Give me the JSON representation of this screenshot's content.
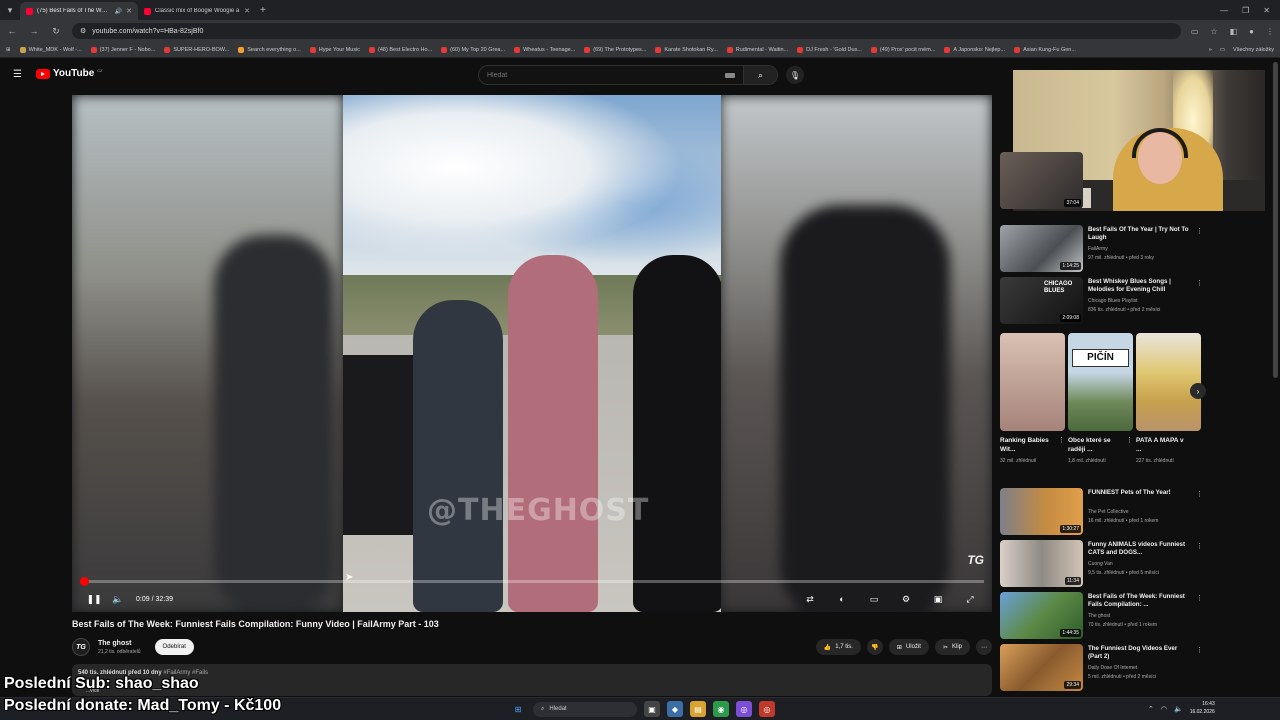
{
  "browser": {
    "tabs": [
      {
        "title": "(75) Best Fails of The Week:",
        "active": true,
        "audio": true
      },
      {
        "title": "Classic mix of Boogie Woogie a",
        "active": false,
        "audio": false
      }
    ],
    "url": "youtube.com/watch?v=HBa-82sjBf0",
    "bookmarks": [
      "White_MDK - Wolf -...",
      "(37) Jenner F - Nobo...",
      "SUPER-HERO-BOW...",
      "Search everything o...",
      "Hype Your Music",
      "(48) Best Electro Ho...",
      "(60) My Top 20 Grea...",
      "Wheatus - Teenage...",
      "(69) The Prototypes...",
      "Karate Shotokan Ry...",
      "Rudimental - Waitin...",
      "DJ Fresh - 'Gold Dus...",
      "(49) Prox' pocit rném...",
      "A Japonsko: Nejlep...",
      "Asian Kung-Fu Gen..."
    ],
    "bookmarks_folder": "Všechny záložky"
  },
  "youtube": {
    "logo_text": "YouTube",
    "logo_region": "CZ",
    "search_placeholder": "Hledat"
  },
  "player": {
    "watermark": "@THEGHOST",
    "channel_mark": "TG",
    "time": "0:09 / 32:39",
    "progress_fraction": 0.0046
  },
  "video": {
    "title": "Best Fails of The Week: Funniest Fails Compilation: Funny Video | FailArmy Part - 103",
    "channel": "The ghost",
    "subscribers": "21,2 tis. odběratelů",
    "subscribe_label": "Odebírat",
    "likes": "1,7 tis.",
    "save_label": "Uložit",
    "clip_label": "Klip",
    "description_meta": "540 tis. zhlédnutí  před 10 dny",
    "description_tags": "#FailArmy #Fails",
    "more_label": "...více"
  },
  "overlay": {
    "line1": "Poslední Sub: shao_shao",
    "line2": "Poslední donate: Mad_Tomy - Kč100"
  },
  "sidebar": {
    "top_duration": "37:04",
    "videos": [
      {
        "title": "Best Fails Of The Year | Try Not To Laugh",
        "channel": "FailArmy",
        "views": "97 mil. zhlédnutí • před 3 roky",
        "duration": "1:14:25",
        "verified": true
      },
      {
        "title": "Best Whiskey Blues Songs | Melodies for Evening Chill",
        "channel": "Chicago Blues Playlist",
        "views": "836 tis. zhlédnutí • před 2 měsíci",
        "duration": "2:09:08",
        "thumb_text": "CHICAGO BLUES"
      },
      {
        "title": "FUNNIEST Pets of The Year!",
        "channel": "The Pet Collective",
        "views": "16 mil. zhlédnutí • před 1 rokem",
        "duration": "1:30:27",
        "verified": true
      },
      {
        "title": "Funny ANIMALS videos Funniest CATS and DOGS...",
        "channel": "Cuong Van",
        "views": "9,5 tis. zhlédnutí • před 5 měsíci",
        "duration": "11:34"
      },
      {
        "title": "Best Fails of The Week: Funniest Fails Compilation: ...",
        "channel": "The ghost",
        "views": "70 tis. zhlédnutí • před 1 rokem",
        "duration": "1:44:35"
      },
      {
        "title": "The Funniest Dog Videos Ever (Part 2)",
        "channel": "Daily Dose Of Internet",
        "views": "5 mil. zhlédnutí • před 2 měsíci",
        "duration": "29:34",
        "verified": true
      }
    ],
    "shorts": [
      {
        "title": "Ranking Babies Wit...",
        "views": "32 mil. zhlédnutí"
      },
      {
        "title": "Obce které se raději ...",
        "views": "1,8 mil. zhlédnutí",
        "thumb_text": "PIČÍN"
      },
      {
        "title": "PATA A MAPA v ...",
        "views": "227 tis. zhlédnutí"
      }
    ]
  },
  "taskbar": {
    "search_placeholder": "Hledat",
    "time": "16:43",
    "date": "16.02.2026"
  },
  "colors": {
    "yt_red": "#ff0000",
    "background": "#0f0f0f",
    "pill": "#272727"
  }
}
